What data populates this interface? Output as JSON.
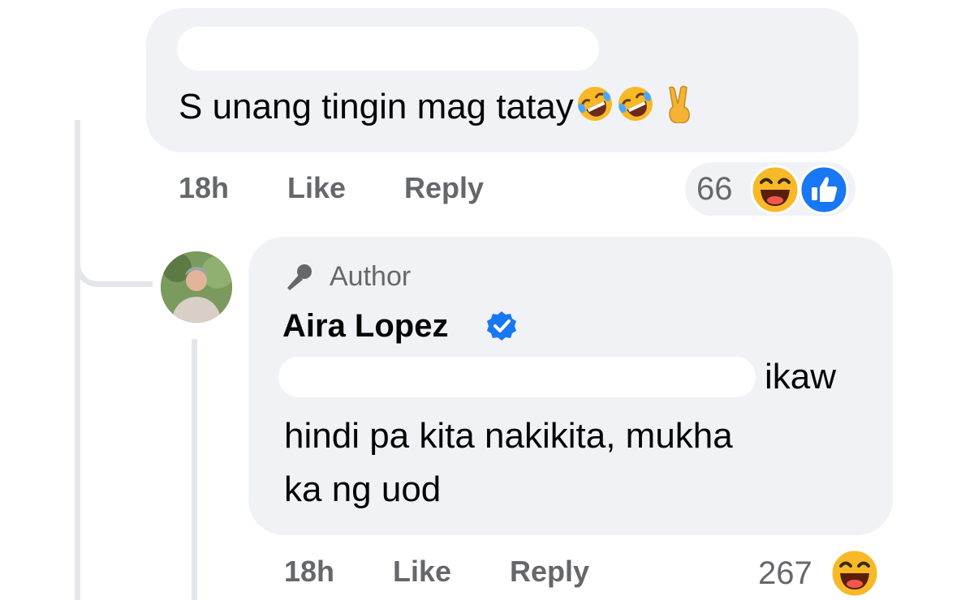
{
  "comment": {
    "text": "S unang tingin mag tatay",
    "emojis": [
      "rolling-on-floor-laughing",
      "rolling-on-floor-laughing",
      "victory-hand"
    ],
    "actions": {
      "time": "18h",
      "like": "Like",
      "reply": "Reply"
    },
    "reaction_count": "66",
    "reactions": [
      "haha",
      "like"
    ]
  },
  "reply": {
    "badge": "Author",
    "author": "Aira Lopez",
    "verified": true,
    "lines": [
      "ikaw",
      "hindi pa kita nakikita, mukha",
      "ka ng uod"
    ],
    "actions": {
      "time": "18h",
      "like": "Like",
      "reply": "Reply"
    },
    "reaction_count": "267",
    "reactions": [
      "haha"
    ]
  },
  "colors": {
    "bubble": "#f0f2f5",
    "meta_text": "#65676b",
    "like_blue": "#1877f2",
    "thread_line": "#e4e6eb",
    "haha_yellow": "#f7b928"
  }
}
